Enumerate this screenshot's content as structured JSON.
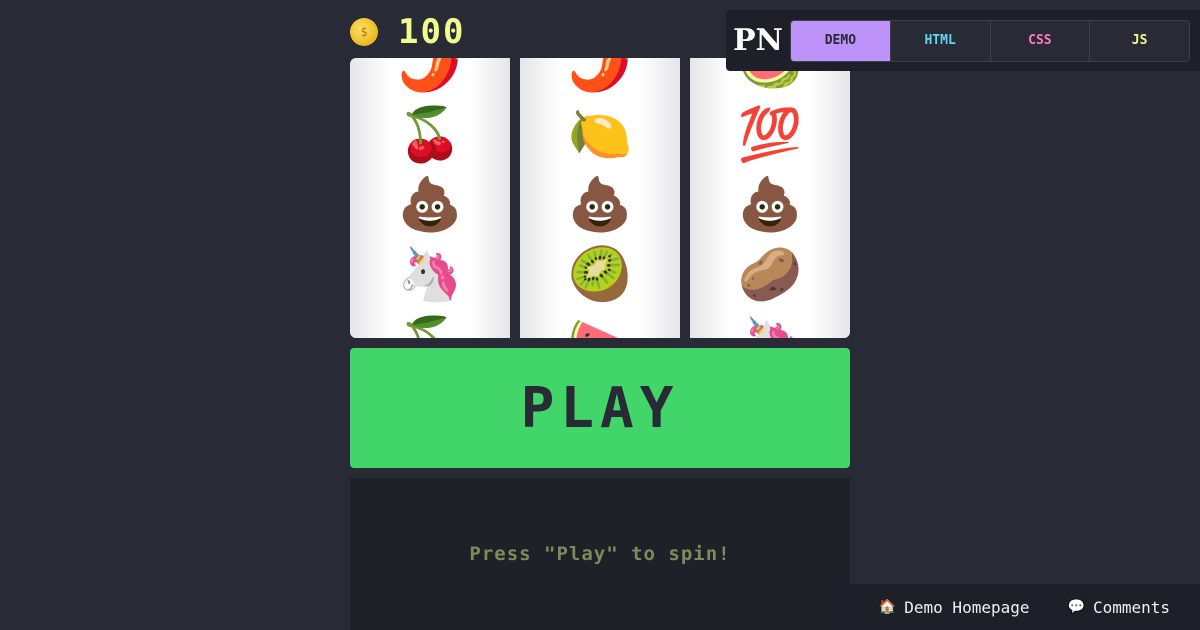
{
  "coins": {
    "icon": "coin-icon",
    "count": "100",
    "glyph": "🪙"
  },
  "reels": [
    {
      "symbols": [
        "🌶️",
        "🍒",
        "💩",
        "🦄",
        "🍒"
      ]
    },
    {
      "symbols": [
        "🌶️",
        "🍋",
        "💩",
        "🥝",
        "🍉"
      ]
    },
    {
      "symbols": [
        "🍉",
        "💯",
        "💩",
        "🥔",
        "🦄"
      ]
    }
  ],
  "play_label": "PLAY",
  "message": "Press \"Play\" to spin!",
  "topbar": {
    "logo": "PN",
    "tabs": [
      {
        "label": "DEMO",
        "color": "#282a36"
      },
      {
        "label": "HTML",
        "color": "#5fd7ef"
      },
      {
        "label": "CSS",
        "color": "#ff79c6"
      },
      {
        "label": "JS",
        "color": "#f1fa8c"
      }
    ]
  },
  "footer": {
    "links": [
      {
        "label": "Demo Homepage",
        "icon": "home-icon",
        "glyph": "🏠"
      },
      {
        "label": "Comments",
        "icon": "comment-icon",
        "glyph": "💬"
      }
    ]
  },
  "colors": {
    "play": "#42d569",
    "demo_tab": "#bd93f9",
    "background": "#282a36"
  }
}
